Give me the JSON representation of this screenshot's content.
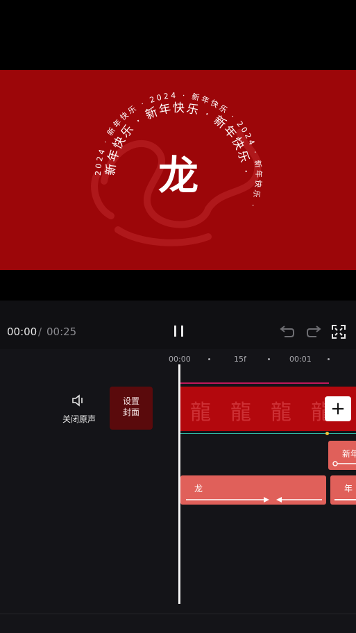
{
  "preview": {
    "main_char": "龙",
    "ring_outer": "2024 · 新年快乐 · 2024 · 新年快乐 · 2024 · 新年快乐 ·",
    "ring_inner": "新年快乐 · 新年快乐 · 新年快乐 ·",
    "colors": {
      "background": "#9c0609",
      "text": "#ffffff",
      "dragon": "#c0272b"
    }
  },
  "controls": {
    "current_time": "00:00",
    "separator": "/",
    "total_time": "00:25",
    "icons": [
      "pause-icon",
      "undo-icon",
      "redo-icon",
      "fullscreen-icon"
    ]
  },
  "timeline": {
    "ruler": [
      "00:00",
      "15f",
      "00:01"
    ],
    "mute_label": "关闭原声",
    "cover_label_line1": "设置",
    "cover_label_line2": "封面",
    "add_button": "+",
    "track_glyph": "龍",
    "clips": {
      "dragon": "龙",
      "year": "年",
      "new_year": "新年"
    },
    "colors": {
      "track": "#b3080d",
      "clip": "#e0605a",
      "accent_line": "#c2185b"
    }
  }
}
